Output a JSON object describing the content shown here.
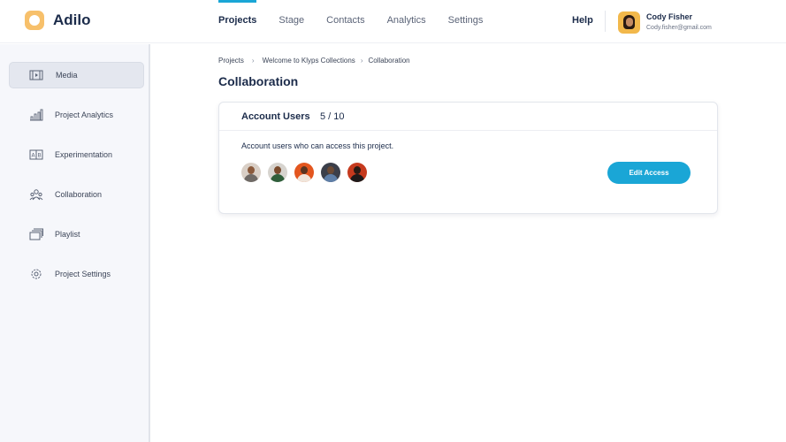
{
  "app": {
    "name": "Adilo"
  },
  "nav": {
    "items": [
      {
        "label": "Projects",
        "active": true
      },
      {
        "label": "Stage"
      },
      {
        "label": "Contacts"
      },
      {
        "label": "Analytics"
      },
      {
        "label": "Settings"
      }
    ],
    "help": "Help"
  },
  "user": {
    "name": "Cody Fisher",
    "email": "Cody.fisher@gmail.com"
  },
  "sidebar": {
    "items": [
      {
        "label": "Media",
        "icon": "media-icon",
        "active": true
      },
      {
        "label": "Project Analytics",
        "icon": "analytics-icon"
      },
      {
        "label": "Experimentation",
        "icon": "experimentation-icon"
      },
      {
        "label": "Collaboration",
        "icon": "collaboration-icon"
      },
      {
        "label": "Playlist",
        "icon": "playlist-icon"
      },
      {
        "label": "Project Settings",
        "icon": "settings-icon"
      }
    ]
  },
  "breadcrumb": [
    "Projects",
    "Welcome to Klyps Collections",
    "Collaboration"
  ],
  "page": {
    "title": "Collaboration"
  },
  "card": {
    "title": "Account Users",
    "count": "5 / 10",
    "description": "Account users who can access this project.",
    "edit_button": "Edit Access"
  },
  "colors": {
    "accent": "#1aa6d6",
    "brand": "#f7c06b",
    "text": "#1b2b4a"
  }
}
